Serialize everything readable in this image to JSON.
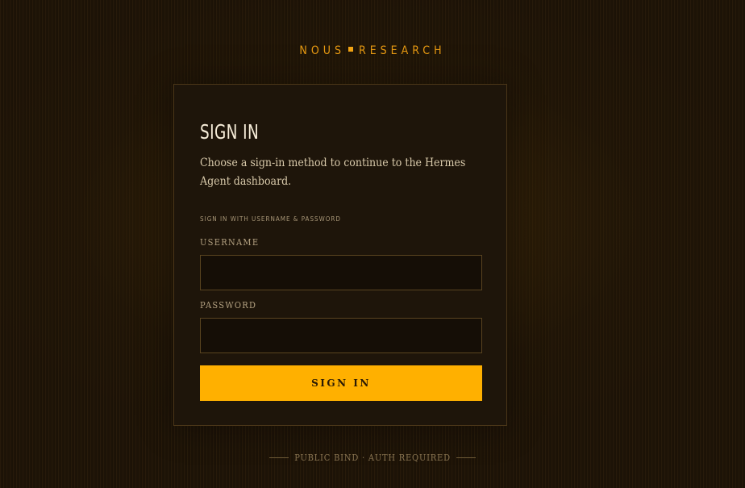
{
  "brand": {
    "left": "NOUS",
    "right": "RESEARCH",
    "accent_color": "#f2a414"
  },
  "card": {
    "title": "SIGN IN",
    "subtitle": "Choose a sign-in method to continue to the Hermes Agent dashboard.",
    "section_label": "SIGN IN WITH USERNAME & PASSWORD",
    "username": {
      "label": "USERNAME",
      "value": ""
    },
    "password": {
      "label": "PASSWORD",
      "value": ""
    },
    "submit_label": "SIGN IN",
    "submit_color": "#ffb000"
  },
  "footer": {
    "text": "PUBLIC BIND · AUTH REQUIRED"
  }
}
